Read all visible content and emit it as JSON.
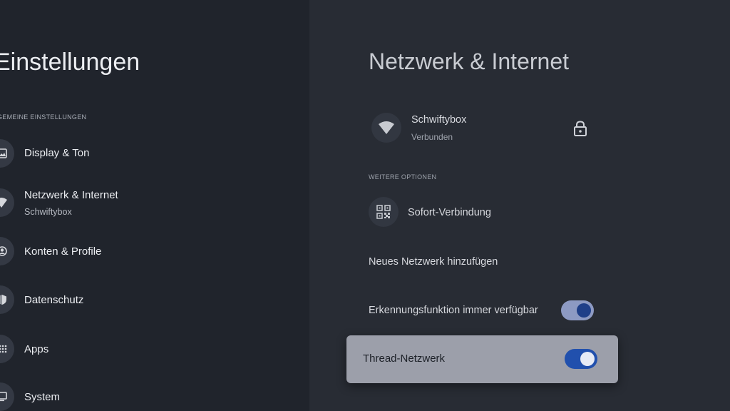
{
  "sidebar": {
    "title": "Einstellungen",
    "section_header": "GEMEINE EINSTELLUNGEN",
    "items": [
      {
        "label": "Display & Ton",
        "icon": "display-icon"
      },
      {
        "label": "Netzwerk & Internet",
        "sublabel": "Schwiftybox",
        "icon": "wifi-icon"
      },
      {
        "label": "Konten & Profile",
        "icon": "account-icon"
      },
      {
        "label": "Datenschutz",
        "icon": "shield-icon"
      },
      {
        "label": "Apps",
        "icon": "apps-icon"
      },
      {
        "label": "System",
        "icon": "system-icon"
      }
    ]
  },
  "detail": {
    "title": "Netzwerk & Internet",
    "network": {
      "name": "Schwiftybox",
      "status": "Verbunden",
      "icon": "wifi-icon",
      "secure_icon": "lock-icon"
    },
    "section_header": "WEITERE OPTIONEN",
    "instant_connect": {
      "label": "Sofort-Verbindung",
      "icon": "qr-code-icon"
    },
    "add_network": {
      "label": "Neues Netzwerk hinzufügen"
    },
    "scanning_always": {
      "label": "Erkennungsfunktion immer verfügbar",
      "enabled": true
    },
    "thread_network": {
      "label": "Thread-Netzwerk",
      "enabled": true
    }
  },
  "colors": {
    "toggle_track_on": "#8d9ac3",
    "toggle_knob_on": "#1f3f88",
    "focused_toggle_track": "#2150ad",
    "focused_toggle_knob": "#e8ecf6",
    "focus_card": "#9c9faa"
  }
}
